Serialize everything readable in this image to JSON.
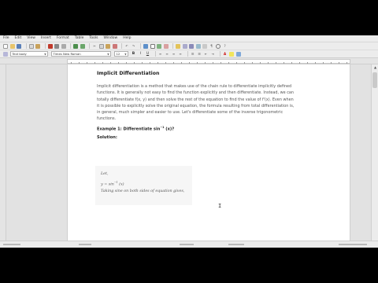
{
  "menu": [
    "File",
    "Edit",
    "View",
    "Insert",
    "Format",
    "Table",
    "Tools",
    "Window",
    "Help"
  ],
  "format_bar": {
    "style_value": "Text body",
    "font_value": "Times New Roman",
    "size_value": "12",
    "bold": "B",
    "italic": "I",
    "underline": "U"
  },
  "document": {
    "heading": "Implicit Differentiation",
    "paragraph_lines": [
      "Implicit differentiation is a method that makes use of the chain rule to differentiate implicitly defined",
      "functions. It is generally not easy to find the function explicitly and then differentiate. Instead, we can",
      "totally differentiate f(x, y) and then solve the rest of the equation to find the value of f'(x). Even when",
      "it is possible to explicitly solve the original equation, the formula resulting from total differentiation is,",
      "in general, much simpler and easier to use. Let's differentiate some of the inverse trigonometric",
      "functions."
    ],
    "example_prefix": "Example 1: Differentiate sin",
    "example_sup": "−1",
    "example_suffix": " (x)?",
    "solution_label": "Solution:",
    "box": {
      "line1": "Let,",
      "line2_prefix": "y = sin",
      "line2_sup": "−1",
      "line2_suffix": " (x)",
      "line3": "Taking sine on both sides of equation gives,"
    }
  },
  "colors": {
    "window_bg": "#e9e9e9",
    "page_bg": "#ffffff",
    "text": "#555555",
    "heading": "#222222"
  }
}
